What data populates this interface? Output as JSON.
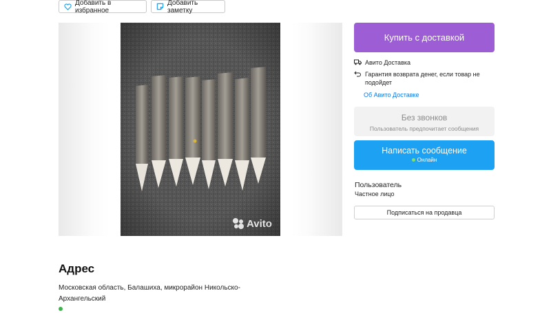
{
  "actions": {
    "favorite_label": "Добавить в избранное",
    "note_label": "Добавить заметку"
  },
  "gallery": {
    "watermark": "Avito"
  },
  "purchase": {
    "buy_label": "Купить с доставкой",
    "delivery_label": "Авито Доставка",
    "guarantee_label": "Гарантия возврата денег, если товар не подойдет",
    "about_link": "Об Авито Доставке"
  },
  "contact": {
    "no_calls_title": "Без звонков",
    "no_calls_subtitle": "Пользователь предпочитает сообщения",
    "message_label": "Написать сообщение",
    "online_label": "Онлайн"
  },
  "seller": {
    "name": "Пользователь",
    "type": "Частное лицо",
    "subscribe_label": "Подписаться на продавца"
  },
  "address": {
    "title": "Адрес",
    "text": "Московская область, Балашиха, микрорайон Никольско-Архангельский"
  },
  "colors": {
    "buy_button": "#9d5dd4",
    "message_button": "#1da1f2",
    "link": "#0a7be4",
    "online_dot": "#7fe06b"
  }
}
